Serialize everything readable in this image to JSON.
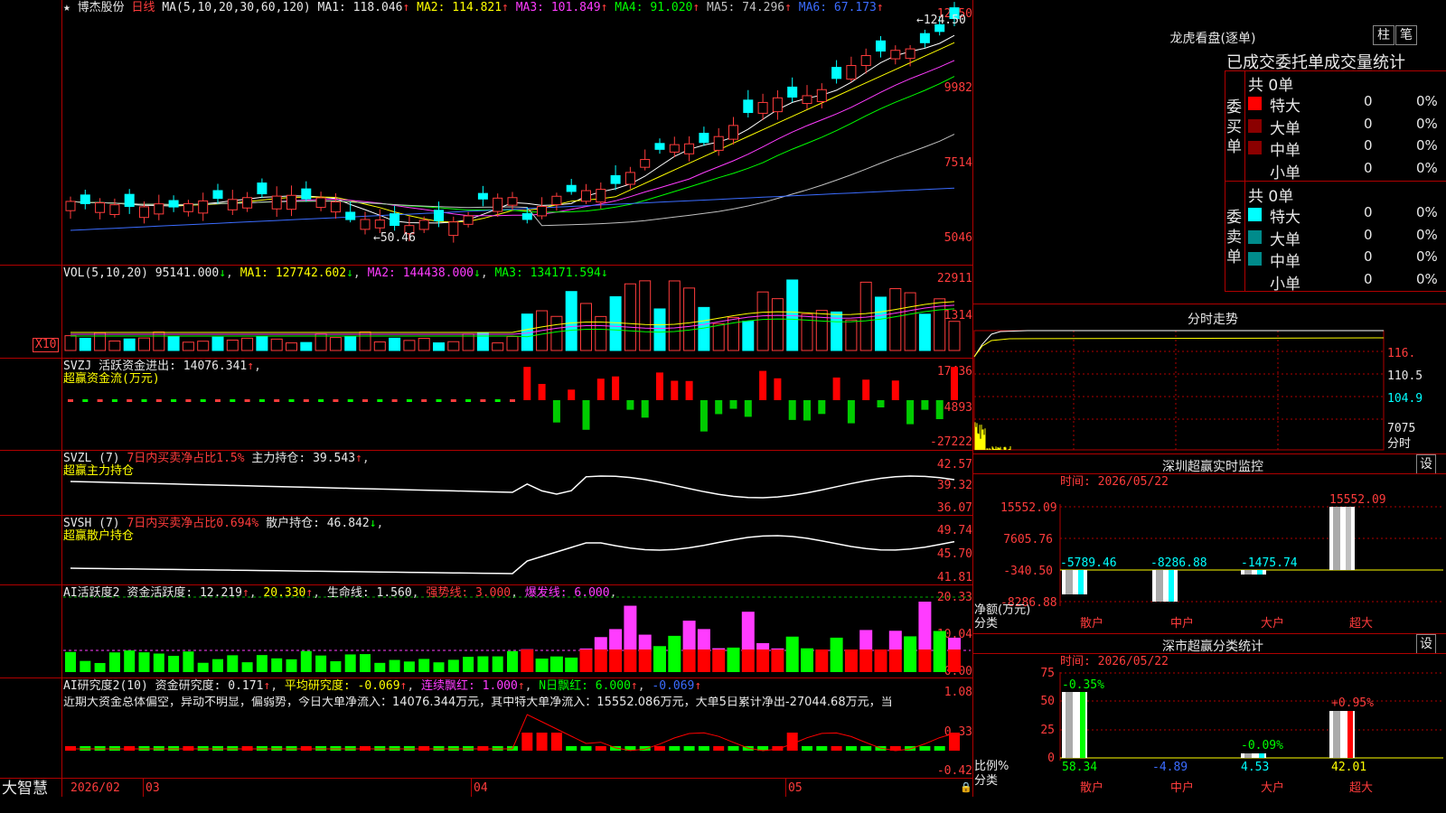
{
  "stock": {
    "name": "博杰股份",
    "period": "日线"
  },
  "app": {
    "brand": "大智慧"
  },
  "ma_line": {
    "label": "MA(5,10,20,30,60,120)",
    "ma1": "MA1: 118.046",
    "ma2": "MA2: 114.821",
    "ma3": "MA3: 101.849",
    "ma4": "MA4: 91.020",
    "ma5": "MA5: 74.296",
    "ma6": "MA6: 67.173",
    "high_note": "124.50",
    "low_note": "50.46"
  },
  "price_axis": [
    "12450",
    "9982",
    "7514",
    "5046"
  ],
  "vol_line": {
    "label": "VOL(5,10,20)",
    "val": "95141.000",
    "ma1": "MA1: 127742.602",
    "ma2": "MA2: 144438.000",
    "ma3": "MA3: 134171.594"
  },
  "vol_axis": [
    "22911",
    "11314"
  ],
  "vol_mult": "X10",
  "svzj": {
    "label": "SVZJ",
    "name": "活跃资金进出: 14076.341",
    "sub": "超赢资金流(万元)",
    "axis": [
      "17436",
      "-4893",
      "-27222"
    ]
  },
  "svzl": {
    "label": "SVZL (7)",
    "name": "7日内买卖净占比1.5%",
    "name2": "主力持仓: 39.543",
    "sub": "超赢主力持仓",
    "axis": [
      "42.57",
      "39.32",
      "36.07"
    ]
  },
  "svsh": {
    "label": "SVSH (7)",
    "name": "7日内买卖净占比0.694%",
    "name2": "散户持仓: 46.842",
    "sub": "超赢散户持仓",
    "axis": [
      "49.74",
      "45.70",
      "41.81"
    ]
  },
  "ai1": {
    "label": "AI活跃度2",
    "v1": "资金活跃度: 12.219",
    "v2": "20.330",
    "v3": "生命线: 1.560",
    "v4": "强势线: 3.000",
    "v5": "爆发线: 6.000",
    "axis": [
      "20.33",
      "10.04",
      "0.00"
    ]
  },
  "ai2": {
    "label": "AI研究度2(10)",
    "v1": "资金研究度: 0.171",
    "v2": "平均研究度: -0.069",
    "v3": "连续飘红: 1.000",
    "v4": "N日飘红: 6.000",
    "v5": "-0.069",
    "comment": "近期大资金总体偏空，异动不明显，偏弱势，今日大单净流入：14076.344万元，其中特大单净流入：15552.086万元，大单5日累计净出-27044.68万元，当",
    "axis": [
      "1.08",
      "0.33",
      "-0.42"
    ]
  },
  "dates": [
    "2026/02",
    "03",
    "04",
    "05"
  ],
  "right": {
    "lhb_title": "龙虎看盘(逐单)",
    "btn_bar": "柱",
    "btn_pen": "笔",
    "table_header": "已成交委托单成交量统计",
    "buy_label": "委买单",
    "sell_label": "委卖单",
    "buy_total": "共 0单",
    "sell_total": "共 0单",
    "rows": [
      "特大",
      "大单",
      "中单",
      "小单"
    ],
    "zero": "0",
    "pct": "0%",
    "ts_title": "分时走势",
    "ts_axis": [
      "116.",
      "110.5",
      "104.9",
      "7075",
      "分时"
    ],
    "sz_title": "深圳超赢实时监控",
    "set": "设",
    "sz_time": "时间: 2026/05/22",
    "sz_axis": [
      "15552.09",
      "7605.76",
      "-340.50",
      "-8286.88"
    ],
    "sz_vals": [
      "-5789.46",
      "-8286.88",
      "-1475.74",
      "15552.09"
    ],
    "sz_unit": "净额(万元)",
    "cat_label": "分类",
    "cats": [
      "散户",
      "中户",
      "大户",
      "超大"
    ],
    "cls_title": "深市超赢分类统计",
    "cls_time": "时间: 2026/05/22",
    "cls_axis": [
      "75",
      "50",
      "25",
      "0"
    ],
    "cls_top": [
      "-0.35%",
      "-0.09%",
      "+0.95%"
    ],
    "cls_vals": [
      "58.34",
      "-4.89",
      "4.53",
      "42.01"
    ],
    "ratio_label": "比例%"
  },
  "colors": {
    "up": "#ff3c3c",
    "down": "#00ffff",
    "grid": "#b00000",
    "ma1": "#ffffff",
    "ma2": "#ffff00",
    "ma3": "#ff3cff",
    "ma4": "#00ff00",
    "ma5": "#c0c0c0",
    "ma6": "#3b6cff"
  }
}
